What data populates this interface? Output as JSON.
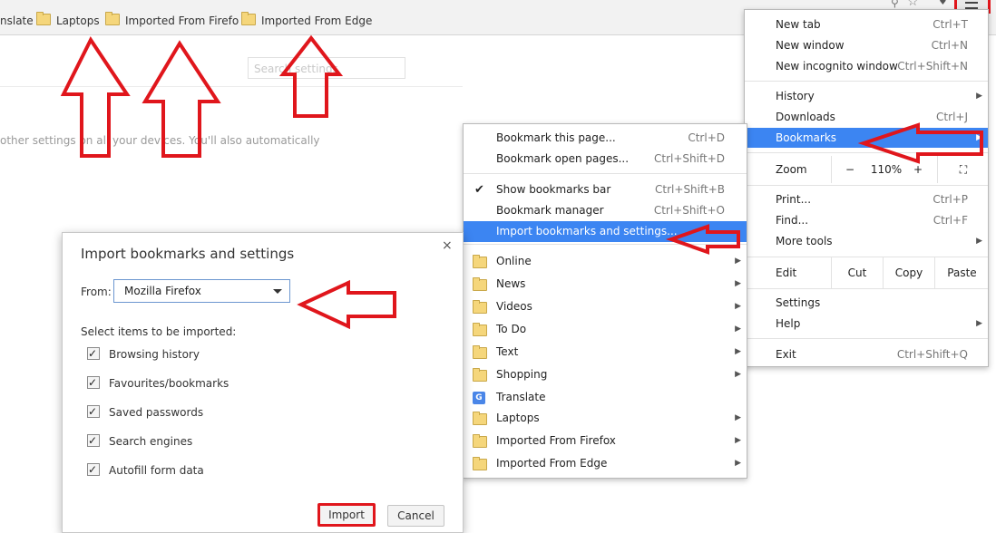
{
  "bookmarks_bar": {
    "items": [
      {
        "label": "nslate",
        "folder": false
      },
      {
        "label": "Laptops",
        "folder": true
      },
      {
        "label": "Imported From Firefo",
        "folder": true
      },
      {
        "label": "Imported From Edge",
        "folder": true
      }
    ]
  },
  "settings_page": {
    "search_placeholder": "Search settings",
    "sync_text": "other settings on all your devices. You'll also automatically"
  },
  "chrome_menu": {
    "new_tab": {
      "label": "New tab",
      "shortcut": "Ctrl+T"
    },
    "new_window": {
      "label": "New window",
      "shortcut": "Ctrl+N"
    },
    "new_incognito": {
      "label": "New incognito window",
      "shortcut": "Ctrl+Shift+N"
    },
    "history": {
      "label": "History"
    },
    "downloads": {
      "label": "Downloads",
      "shortcut": "Ctrl+J"
    },
    "bookmarks": {
      "label": "Bookmarks"
    },
    "zoom": {
      "label": "Zoom",
      "minus": "−",
      "level": "110%",
      "plus": "+",
      "fullscreen": "⛶"
    },
    "print": {
      "label": "Print...",
      "shortcut": "Ctrl+P"
    },
    "find": {
      "label": "Find...",
      "shortcut": "Ctrl+F"
    },
    "more_tools": {
      "label": "More tools"
    },
    "edit": {
      "label": "Edit",
      "cut": "Cut",
      "copy": "Copy",
      "paste": "Paste"
    },
    "settings": {
      "label": "Settings"
    },
    "help": {
      "label": "Help"
    },
    "exit": {
      "label": "Exit",
      "shortcut": "Ctrl+Shift+Q"
    }
  },
  "bookmarks_submenu": {
    "bookmark_page": {
      "label": "Bookmark this page...",
      "shortcut": "Ctrl+D"
    },
    "bookmark_open": {
      "label": "Bookmark open pages...",
      "shortcut": "Ctrl+Shift+D"
    },
    "show_bar": {
      "label": "Show bookmarks bar",
      "shortcut": "Ctrl+Shift+B",
      "checked": true
    },
    "manager": {
      "label": "Bookmark manager",
      "shortcut": "Ctrl+Shift+O"
    },
    "import": {
      "label": "Import bookmarks and settings..."
    },
    "folders": [
      {
        "label": "Online",
        "arrow": true,
        "icon": "folder-icon"
      },
      {
        "label": "News",
        "arrow": true,
        "icon": "folder-icon"
      },
      {
        "label": "Videos",
        "arrow": true,
        "icon": "folder-icon"
      },
      {
        "label": "To Do",
        "arrow": true,
        "icon": "folder-icon"
      },
      {
        "label": "Text",
        "arrow": true,
        "icon": "folder-icon"
      },
      {
        "label": "Shopping",
        "arrow": true,
        "icon": "folder-icon"
      },
      {
        "label": "Translate",
        "arrow": false,
        "icon": "google-translate-icon"
      },
      {
        "label": "Laptops",
        "arrow": true,
        "icon": "folder-icon"
      },
      {
        "label": "Imported From Firefox",
        "arrow": true,
        "icon": "folder-icon"
      },
      {
        "label": "Imported From Edge",
        "arrow": true,
        "icon": "folder-icon"
      }
    ]
  },
  "import_dialog": {
    "title": "Import bookmarks and settings",
    "close": "×",
    "from_label": "From:",
    "from_value": "Mozilla Firefox",
    "items_label": "Select items to be imported:",
    "items": [
      {
        "label": "Browsing history",
        "checked": true
      },
      {
        "label": "Favourites/bookmarks",
        "checked": true
      },
      {
        "label": "Saved passwords",
        "checked": true
      },
      {
        "label": "Search engines",
        "checked": true
      },
      {
        "label": "Autofill form data",
        "checked": true
      }
    ],
    "import_button": "Import",
    "cancel_button": "Cancel"
  },
  "colors": {
    "highlight": "#3c85f2",
    "annotation": "#e0161c"
  }
}
